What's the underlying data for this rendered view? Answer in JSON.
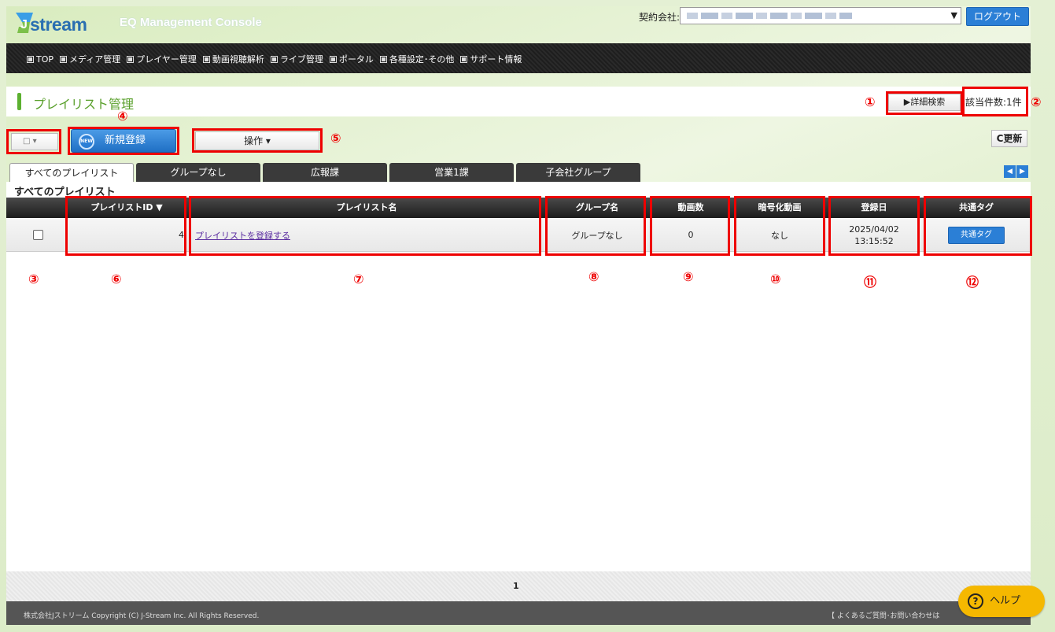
{
  "header": {
    "brand": "stream",
    "brand_initial": "J",
    "console_title": "EQ Management Console",
    "contract_label": "契約会社:",
    "logout_label": "ログアウト"
  },
  "nav": {
    "items": [
      "TOP",
      "メディア管理",
      "プレイヤー管理",
      "動画視聴解析",
      "ライブ管理",
      "ポータル",
      "各種設定･その他",
      "サポート情報"
    ]
  },
  "page": {
    "title": "プレイリスト管理",
    "advanced_search_label": "▶詳細検索",
    "result_count": "該当件数:1件"
  },
  "toolbar": {
    "checkbox_dropdown": "□ ▾",
    "new_badge": "NEW",
    "new_button": "新規登録",
    "operations_button": "操作 ▾",
    "refresh_button": "C更新"
  },
  "tabs": [
    "すべてのプレイリスト",
    "グループなし",
    "広報課",
    "営業1課",
    "子会社グループ"
  ],
  "panel_title": "すべてのプレイリスト",
  "table": {
    "headers": [
      "プレイリストID ▼",
      "プレイリスト名",
      "グループ名",
      "動画数",
      "暗号化動画",
      "登録日",
      "共通タグ"
    ],
    "row": {
      "id": "4",
      "name": "プレイリストを登録する",
      "group": "グループなし",
      "video_count": "0",
      "encrypted": "なし",
      "date": "2025/04/02",
      "time": "13:15:52",
      "tag_button": "共通タグ"
    }
  },
  "annotations": [
    "①",
    "②",
    "③",
    "④",
    "⑤",
    "⑥",
    "⑦",
    "⑧",
    "⑨",
    "⑩",
    "⑪",
    "⑫"
  ],
  "pager": {
    "current": "1"
  },
  "footer": {
    "copyright": "株式会社Jストリーム Copyright (C) J-Stream Inc. All Rights Reserved.",
    "faq": "【 よくあるご質問･お問い合わせは"
  },
  "help": {
    "icon": "?",
    "label": "ヘルプ"
  },
  "colors": {
    "accent_blue": "#2b7fd6",
    "title_green": "#5aa02c",
    "highlight_red": "#e00000"
  }
}
